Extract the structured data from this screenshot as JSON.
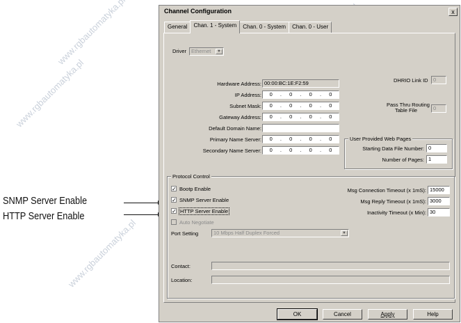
{
  "callouts": {
    "snmp": "SNMP Server Enable",
    "http": "HTTP Server Enable"
  },
  "watermark": "www.rgbautomatyka.pl",
  "dialog": {
    "title": "Channel Configuration",
    "close": "x",
    "tabs": [
      "General",
      "Chan. 1 - System",
      "Chan. 0 - System",
      "Chan. 0 - User"
    ],
    "driver_label": "Driver",
    "driver_value": "Ethernet",
    "hardware_address_label": "Hardware Address:",
    "hardware_address": "00:00:BC:1E:F2:59",
    "ip_address_label": "IP Address:",
    "subnet_mask_label": "Subnet Mask:",
    "gateway_label": "Gateway Address:",
    "domain_label": "Default Domain Name:",
    "primary_ns_label": "Primary Name Server:",
    "secondary_ns_label": "Secondary Name Server:",
    "zero": "0",
    "dot": ".",
    "dhrio_label": "DHRIO Link ID",
    "dhrio_value": "0",
    "passthru_label_1": "Pass Thru Routing",
    "passthru_label_2": "Table File",
    "passthru_value": "0",
    "web_group": "User Provided Web Pages",
    "start_file_label": "Starting Data File Number:",
    "start_file_value": "0",
    "num_pages_label": "Number of Pages:",
    "num_pages_value": "1",
    "protocol_group": "Protocol Control",
    "bootp": "Bootp Enable",
    "snmp": "SNMP Server Enable",
    "http": "HTTP Server Enable",
    "autoneg": "Auto Negotiate",
    "check": "✓",
    "port_label": "Port Setting",
    "port_value": "10 Mbps Half Duplex Forced",
    "msg_conn_label": "Msg Connection Timeout (x 1mS):",
    "msg_conn_value": "15000",
    "msg_reply_label": "Msg Reply Timeout (x 1mS):",
    "msg_reply_value": "3000",
    "inactivity_label": "Inactivity Timeout (x Min):",
    "inactivity_value": "30",
    "contact_label": "Contact:",
    "location_label": "Location:",
    "ok": "OK",
    "cancel": "Cancel",
    "apply": "Apply",
    "help": "Help"
  }
}
